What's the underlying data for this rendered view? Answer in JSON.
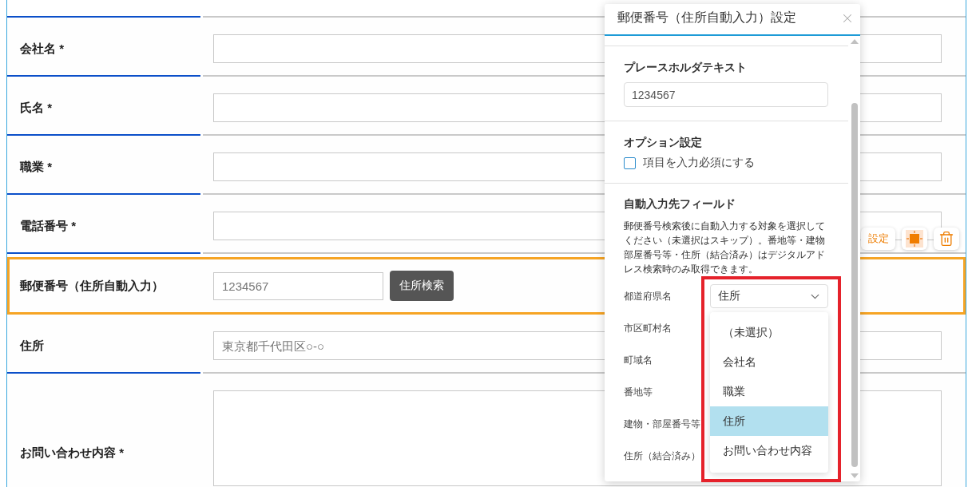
{
  "form": {
    "rows": [
      {
        "label": "会社名 *",
        "kind": "text",
        "selected": false
      },
      {
        "label": "氏名 *",
        "kind": "text",
        "selected": false
      },
      {
        "label": "職業 *",
        "kind": "text",
        "selected": false
      },
      {
        "label": "電話番号 *",
        "kind": "text",
        "selected": false
      },
      {
        "label": "郵便番号（住所自動入力）",
        "kind": "postal",
        "selected": true,
        "placeholder": "1234567",
        "button": "住所検索"
      },
      {
        "label": "住所",
        "kind": "text",
        "selected": false,
        "placeholder": "東京都千代田区○-○"
      },
      {
        "label": "お問い合わせ内容 *",
        "kind": "textarea",
        "selected": false
      }
    ]
  },
  "row_toolbar": {
    "buttons": [
      {
        "kind": "text",
        "label": "設定"
      },
      {
        "kind": "square"
      },
      {
        "kind": "trash"
      }
    ]
  },
  "settings_panel": {
    "title": "郵便番号（住所自動入力）設定",
    "placeholder_section": {
      "title": "プレースホルダテキスト",
      "value": "1234567"
    },
    "option_section": {
      "title": "オプション設定",
      "checkbox": {
        "label": "項目を入力必須にする",
        "checked": false
      }
    },
    "autofill_section": {
      "title": "自動入力先フィールド",
      "description": "郵便番号検索後に自動入力する対象を選択してください（未選択はスキップ）。番地等・建物部屋番号等・住所（結合済み）はデジタルアドレス検索時のみ取得できます。",
      "fields": [
        {
          "label": "都道府県名",
          "value": "住所",
          "expanded": true,
          "options": [
            {
              "label": "（未選択）",
              "selected": false
            },
            {
              "label": "会社名",
              "selected": false
            },
            {
              "label": "職業",
              "selected": false
            },
            {
              "label": "住所",
              "selected": true
            },
            {
              "label": "お問い合わせ内容",
              "selected": false
            }
          ]
        },
        {
          "label": "市区町村名"
        },
        {
          "label": "町域名"
        },
        {
          "label": "番地等"
        },
        {
          "label": "建物・部屋番号等"
        },
        {
          "label": "住所（結合済み）"
        }
      ]
    }
  }
}
